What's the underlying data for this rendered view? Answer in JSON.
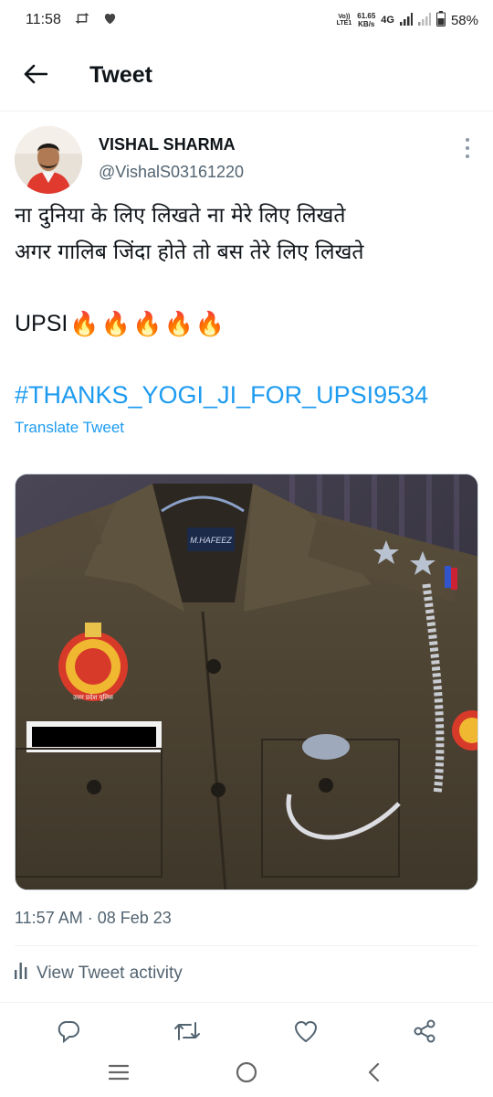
{
  "status_bar": {
    "time": "11:58",
    "volte_top": "Vo))",
    "volte_bottom": "LTE1",
    "speed_top": "61.65",
    "speed_bottom": "KB/s",
    "network": "4G",
    "battery": "58%"
  },
  "header": {
    "title": "Tweet"
  },
  "author": {
    "name": "VISHAL SHARMA",
    "handle": "@VishalS03161220"
  },
  "tweet": {
    "line1": "ना दुनिया के लिए लिखते ना मेरे लिए लिखते",
    "line2": "अगर गालिब जिंदा होते तो बस तेरे लिए लिखते",
    "upsi": "UPSI",
    "fires": [
      "🔥",
      "🔥",
      "🔥",
      "🔥",
      "🔥"
    ],
    "hashtag": "#THANKS_YOGI_JI_FOR_UPSI9534",
    "translate": "Translate Tweet"
  },
  "media": {
    "hanger_label": "M.HAFEEZ",
    "badge_bottom_text": "उत्तर प्रदेश पुलिस"
  },
  "meta": {
    "timestamp": "11:57 AM · 08 Feb 23",
    "activity": "View Tweet activity"
  },
  "icons": {
    "back": "arrow-left-icon",
    "more": "vertical-dots-icon",
    "reply": "comment-icon",
    "retweet": "retweet-icon",
    "like": "heart-icon",
    "share": "share-icon",
    "activity": "bar-chart-icon",
    "nav_recent": "menu-lines-icon",
    "nav_home": "circle-icon",
    "nav_back": "chevron-left-icon"
  },
  "colors": {
    "accent": "#1d9bf0",
    "text": "#0f1419",
    "muted": "#536471"
  }
}
